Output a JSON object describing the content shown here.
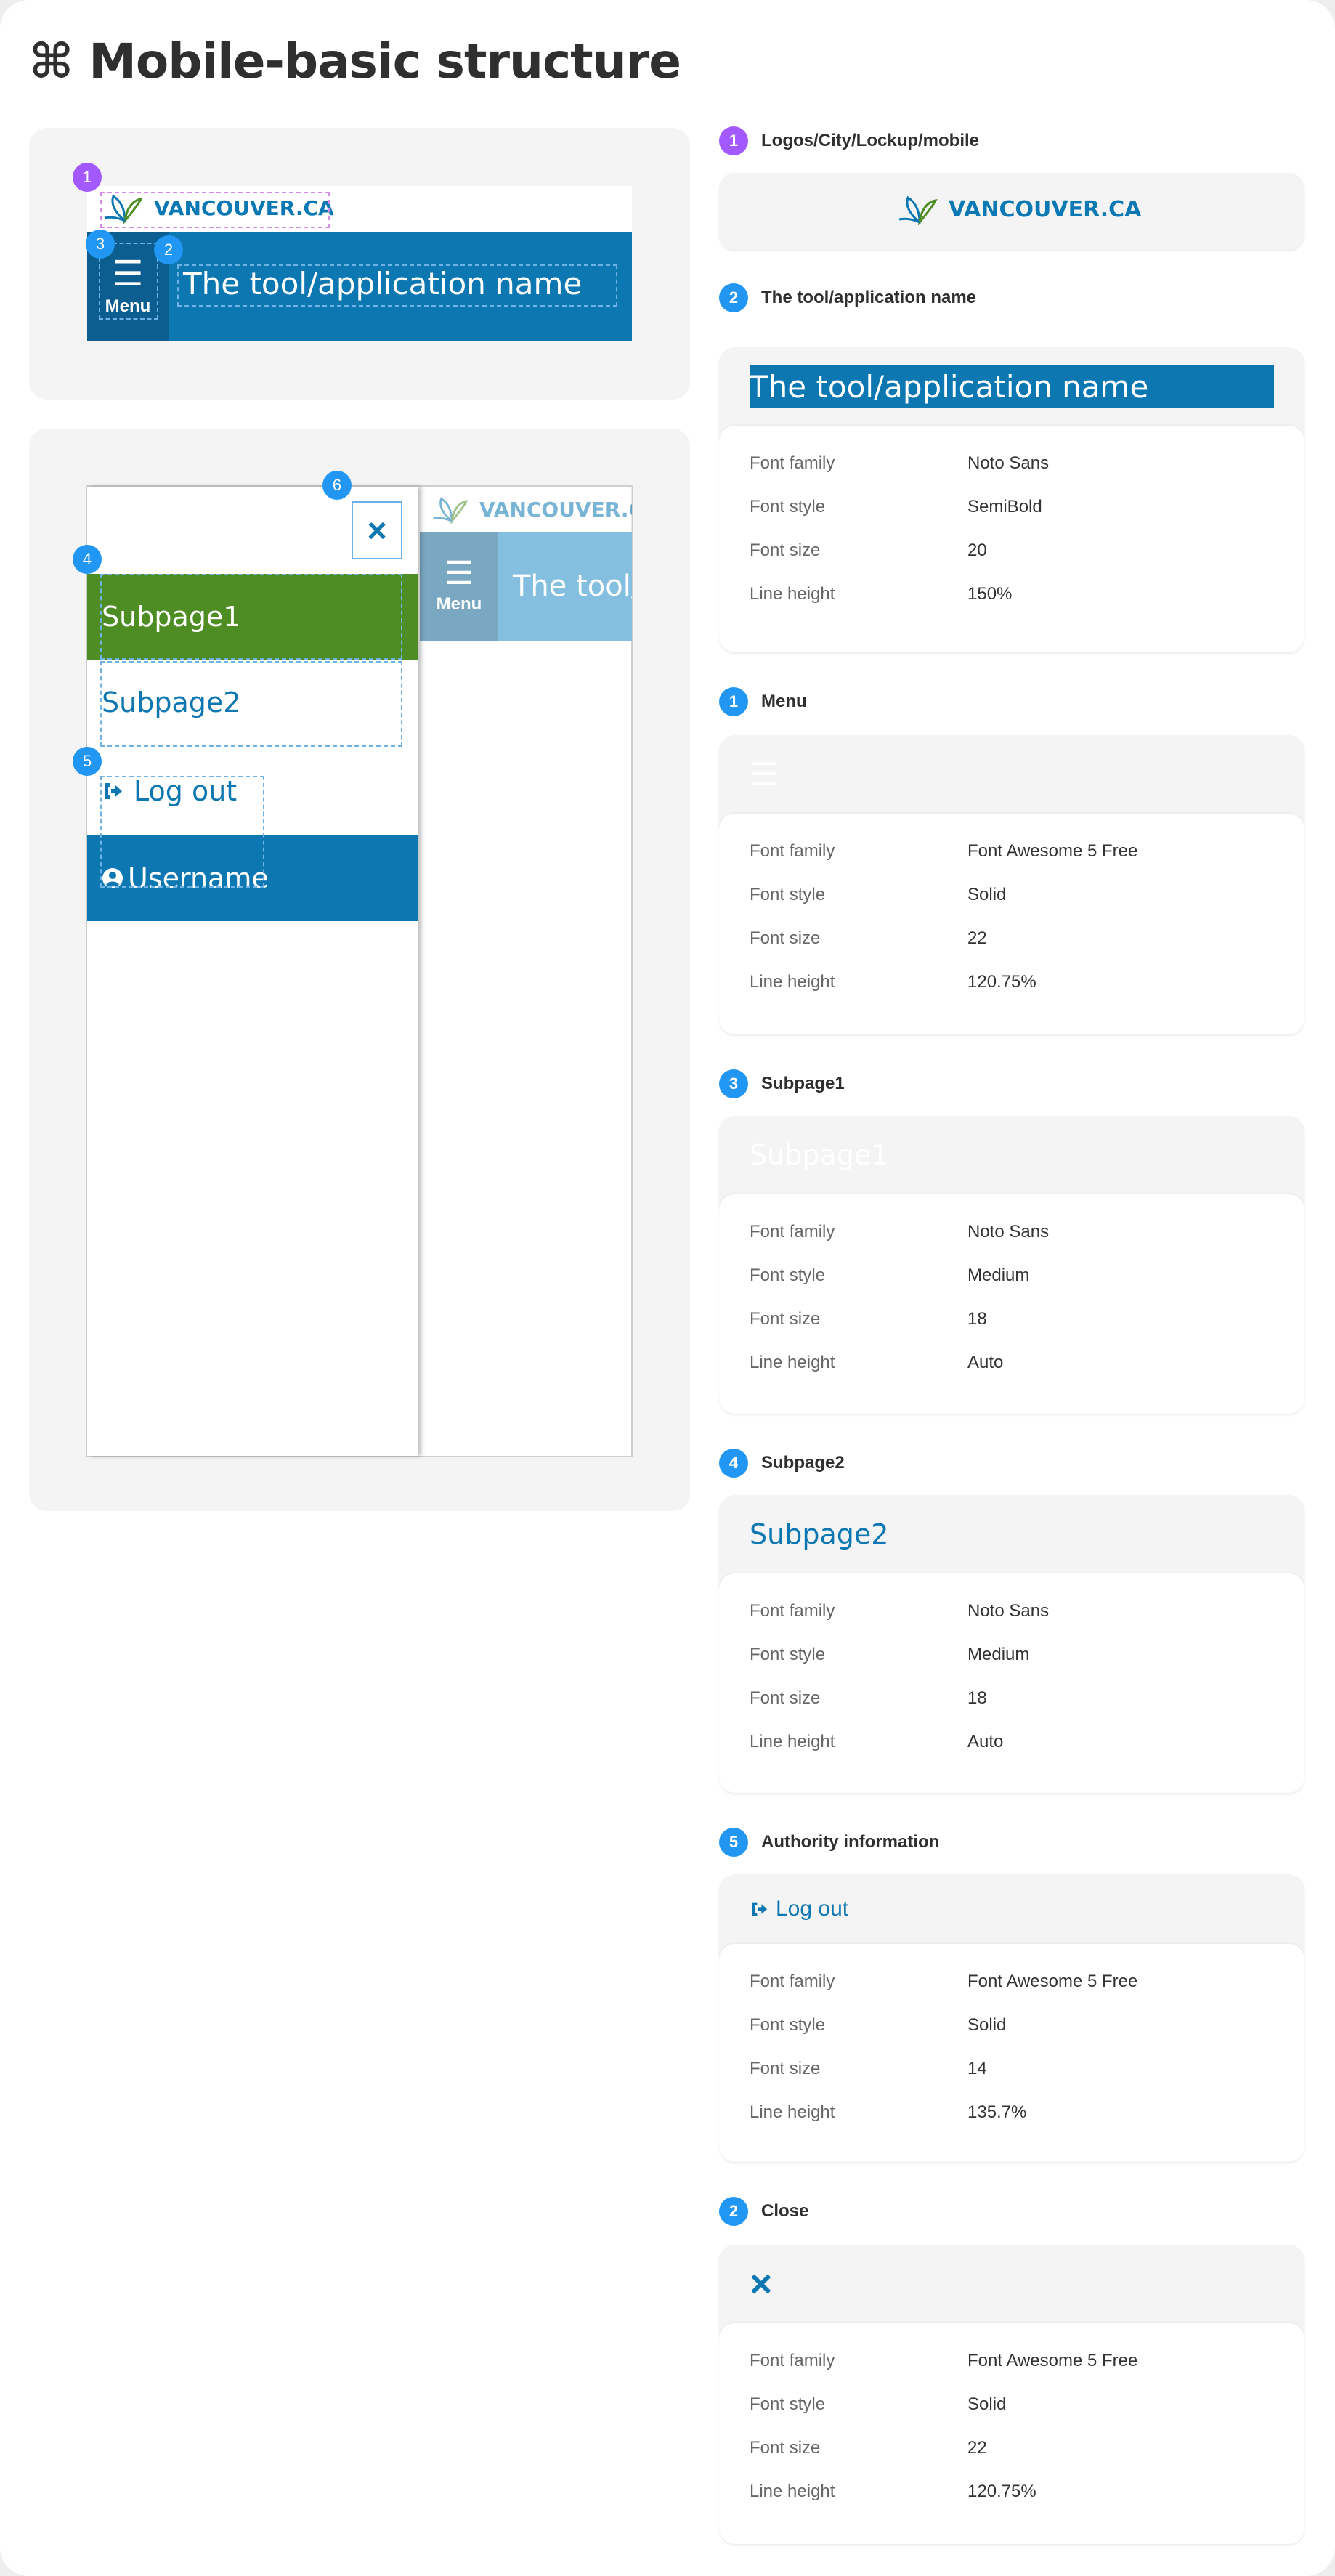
{
  "title": "⌘ Mobile-basic structure",
  "colors": {
    "brand_blue": "#0d77b2",
    "menu_dark": "#0b5e8f",
    "green": "#4d8d23",
    "badge_purple": "#a259ff",
    "badge_blue": "#2196f3"
  },
  "mockup": {
    "logo_text": "VANCOUVER.CA",
    "menu_label": "Menu",
    "menu_icon": "bars-icon",
    "app_name": "The tool/application name",
    "app_name_truncated": "The tool/",
    "badges": [
      "1",
      "2",
      "3",
      "4",
      "5",
      "6"
    ],
    "drawer": {
      "close_icon": "×",
      "subpage1": "Subpage1",
      "subpage2": "Subpage2",
      "logout": "Log out",
      "username": "Username"
    }
  },
  "specs": {
    "labels": {
      "family": "Font family",
      "style": "Font style",
      "size": "Font size",
      "line": "Line height"
    },
    "logo": {
      "badge": "1",
      "title": "Logos/City/Lockup/mobile",
      "preview": "VANCOUVER.CA"
    },
    "app": {
      "badge": "2",
      "title": "The tool/application name",
      "preview": "The tool/application name",
      "family": "Noto Sans",
      "style": "SemiBold",
      "size": "20",
      "line": "150%"
    },
    "menu": {
      "badge": "1",
      "title": "Menu",
      "family": "Font Awesome 5 Free",
      "style": "Solid",
      "size": "22",
      "line": "120.75%"
    },
    "sub1": {
      "badge": "3",
      "title": "Subpage1",
      "preview": "Subpage1",
      "family": "Noto Sans",
      "style": "Medium",
      "size": "18",
      "line": "Auto"
    },
    "sub2": {
      "badge": "4",
      "title": "Subpage2",
      "preview": "Subpage2",
      "family": "Noto Sans",
      "style": "Medium",
      "size": "18",
      "line": "Auto"
    },
    "auth": {
      "badge": "5",
      "title": "Authority information",
      "preview": "Log out",
      "family": "Font Awesome 5 Free",
      "style": "Solid",
      "size": "14",
      "line": "135.7%"
    },
    "close": {
      "badge": "2",
      "title": "Close",
      "preview": "×",
      "family": "Font Awesome 5 Free",
      "style": "Solid",
      "size": "22",
      "line": "120.75%"
    }
  }
}
